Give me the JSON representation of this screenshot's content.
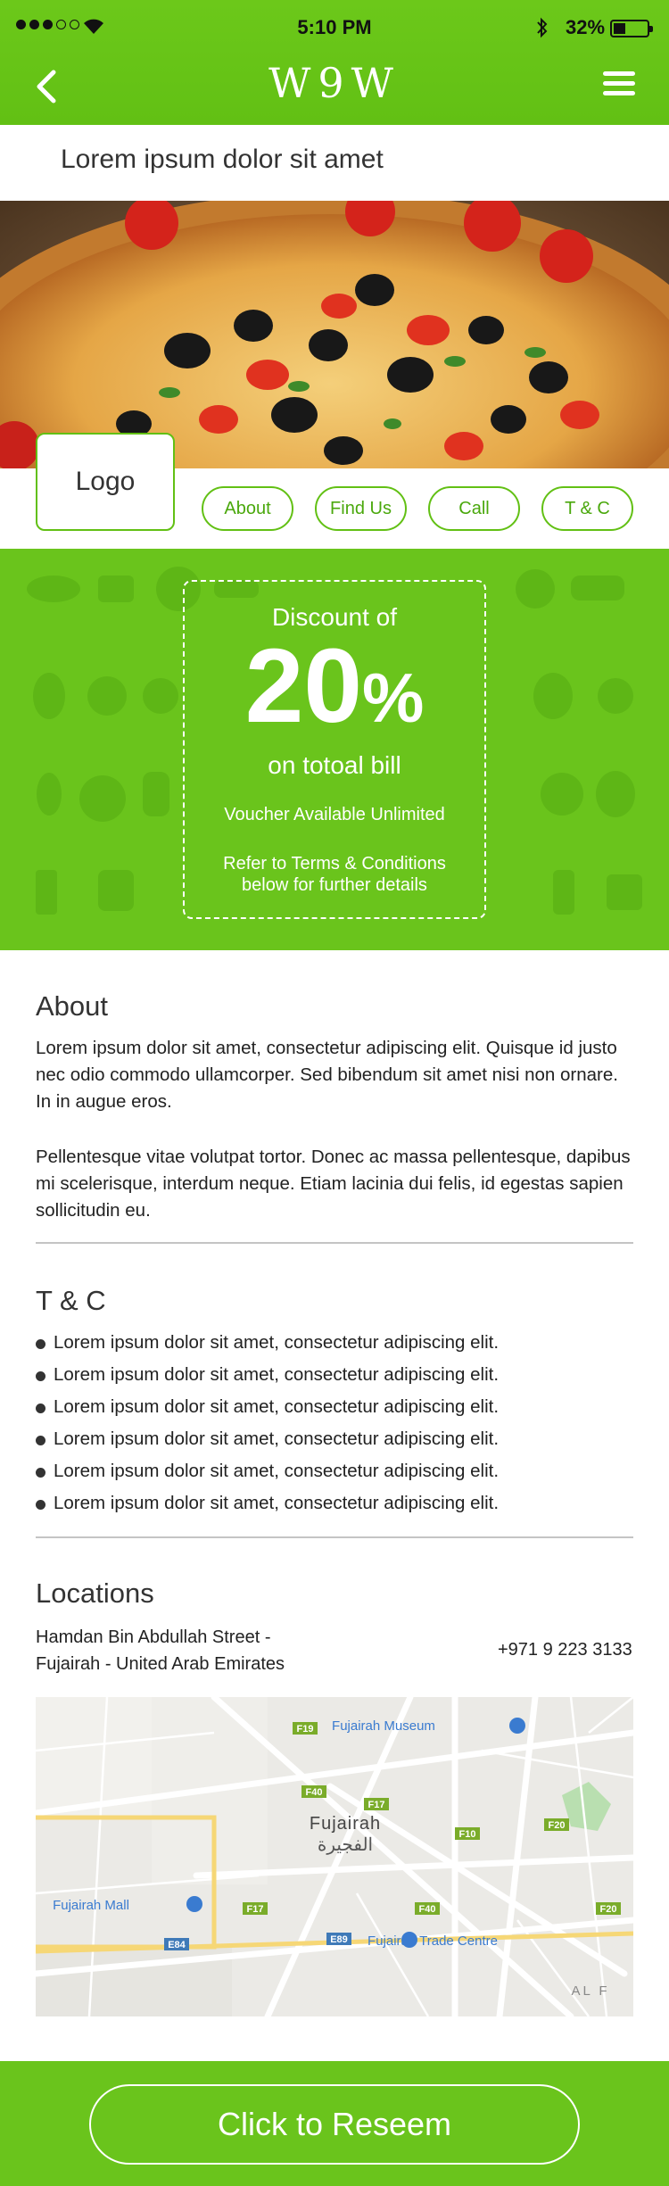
{
  "status_bar": {
    "time": "5:10 PM",
    "battery": "32%"
  },
  "header": {
    "brand": "W9W",
    "title": "Lorem ipsum dolor sit amet"
  },
  "hero": {
    "logo_label": "Logo"
  },
  "nav_pills": [
    "About",
    "Find Us",
    "Call",
    "T & C"
  ],
  "voucher": {
    "discount_label": "Discount of",
    "value": "20",
    "unit": "%",
    "bill": "on totoal bill",
    "availability": "Voucher Available Unlimited",
    "refer_line1": "Refer to Terms & Conditions",
    "refer_line2": "below for further details"
  },
  "about": {
    "title": "About",
    "p1": "Lorem ipsum dolor sit amet, consectetur adipiscing elit. Quisque id justo nec odio commodo ullamcorper. Sed bibendum sit amet nisi non ornare. In in augue eros.",
    "p2": "Pellentesque vitae volutpat tortor. Donec ac massa pellentesque, dapibus mi scelerisque, interdum neque. Etiam lacinia dui felis, id egestas sapien sollicitudin eu."
  },
  "tc": {
    "title": "T & C",
    "items": [
      "Lorem ipsum dolor sit amet, consectetur adipiscing elit.",
      "Lorem ipsum dolor sit amet, consectetur adipiscing elit.",
      "Lorem ipsum dolor sit amet, consectetur adipiscing elit.",
      "Lorem ipsum dolor sit amet, consectetur adipiscing elit.",
      "Lorem ipsum dolor sit amet, consectetur adipiscing elit.",
      "Lorem ipsum dolor sit amet, consectetur adipiscing elit."
    ]
  },
  "locations": {
    "title": "Locations",
    "address_line1": "Hamdan Bin Abdullah Street -",
    "address_line2": "Fujairah - United Arab Emirates",
    "phone": "+971 9 223 3133"
  },
  "map": {
    "city": "Fujairah",
    "city_ar": "الفجيرة",
    "museum": "Fujairah Museum",
    "mall": "Fujairah Mall",
    "trade": "Fujairah Trade Centre",
    "corner": "AL F",
    "road_labels": [
      "F19",
      "F40",
      "F17",
      "F10",
      "F20",
      "F17",
      "F40",
      "F20",
      "E84",
      "E89"
    ]
  },
  "cta": {
    "label": "Click to Reseem"
  },
  "colors": {
    "brand_green": "#62c014",
    "voucher_green": "#6ac41c"
  }
}
